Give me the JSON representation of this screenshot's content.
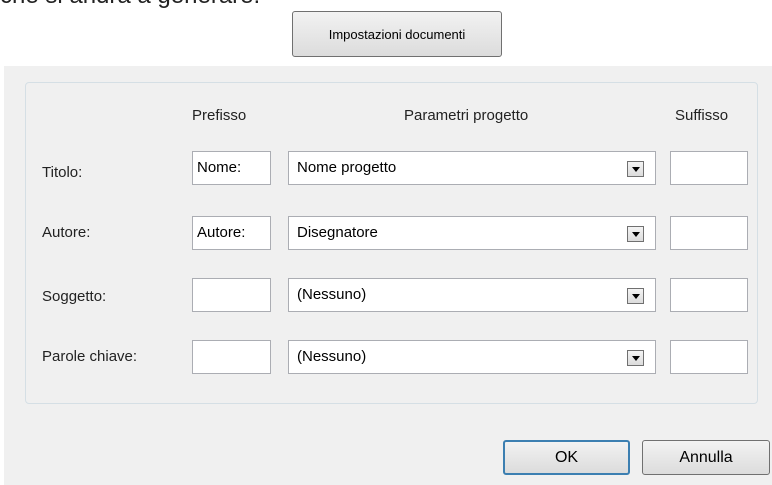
{
  "clipped_text": "che si andrà a generare.",
  "toolbar": {
    "doc_settings_label": "Impostazioni documenti"
  },
  "headers": {
    "prefix": "Prefisso",
    "project_params": "Parametri progetto",
    "suffix": "Suffisso"
  },
  "rows": [
    {
      "label": "Titolo:",
      "prefix": "Nome:",
      "param": "Nome progetto",
      "suffix": ""
    },
    {
      "label": "Autore:",
      "prefix": "Autore:",
      "param": "Disegnatore",
      "suffix": ""
    },
    {
      "label": "Soggetto:",
      "prefix": "",
      "param": "(Nessuno)",
      "suffix": ""
    },
    {
      "label": "Parole chiave:",
      "prefix": "",
      "param": "(Nessuno)",
      "suffix": ""
    }
  ],
  "buttons": {
    "ok": "OK",
    "cancel": "Annulla"
  }
}
